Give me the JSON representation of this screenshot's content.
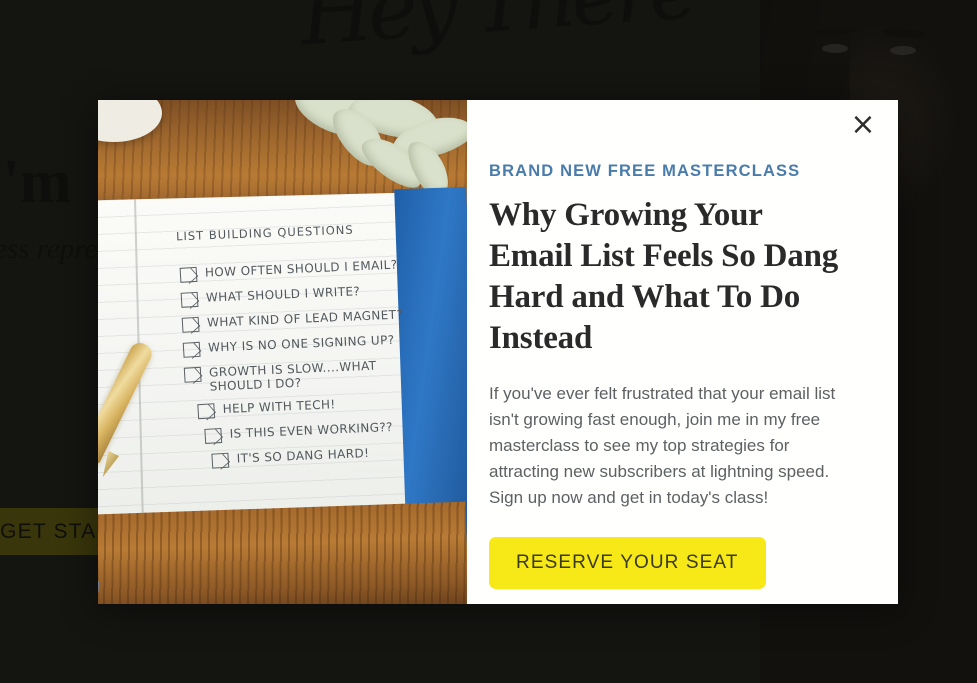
{
  "background": {
    "logo_text": "Hey There",
    "heading": "Hi, I'm",
    "paragraph": "ach business\nrepreneurs\nbuilding\nting online\ng online\ncase.",
    "cta_label": "LET'S GET STARTED",
    "cta_color": "#e9dc13",
    "page_bg_color": "#333330",
    "overlay_color": "rgba(12,12,10,0.80)"
  },
  "modal": {
    "close_icon": "close-icon",
    "close_glyph": "×",
    "panel_color": "#fffffd",
    "eyebrow": "BRAND NEW FREE MASTERCLASS",
    "eyebrow_color": "#4a7cab",
    "headline": "Why Growing Your Email List Feels So Dang Hard and What To Do Instead",
    "headline_color": "#2a2a2a",
    "blurb": "If you've ever felt frustrated that your email list isn't growing fast enough, join me in my free masterclass to see my top strategies for attracting new subscribers at lightning speed. Sign up now and get in today's class!",
    "blurb_color": "#5d6163",
    "cta_label": "RESERVE YOUR SEAT",
    "cta_bg_color": "#f7e817",
    "cta_text_color": "#3a3a1c",
    "photo": {
      "notebook_title": "LIST BUILDING QUESTIONS",
      "checklist": [
        "HOW OFTEN SHOULD I EMAIL?",
        "WHAT SHOULD I WRITE?",
        "WHAT KIND OF LEAD MAGNET?",
        "WHY IS NO ONE SIGNING UP?",
        "GROWTH IS SLOW....WHAT\nSHOULD I DO?",
        "HELP WITH TECH!",
        "IS THIS EVEN WORKING??",
        "IT'S SO DANG HARD!"
      ]
    }
  }
}
